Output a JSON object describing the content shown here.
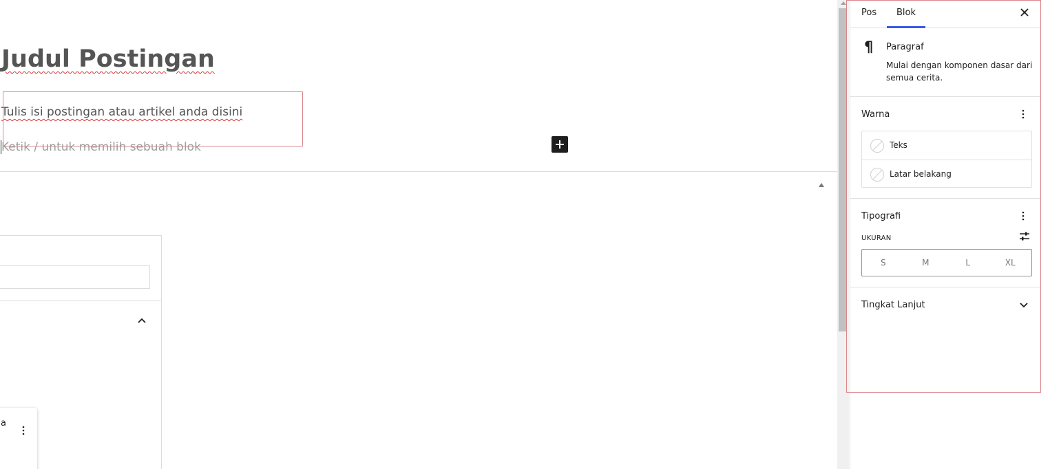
{
  "editor": {
    "post_title": "Judul Postingan",
    "paragraph_text": "Tulis isi postingan atau artikel anda disini",
    "appender_placeholder": "Ketik / untuk memilih sebuah blok",
    "popover_text": "a"
  },
  "sidebar": {
    "tabs": [
      {
        "label": "Pos",
        "active": false
      },
      {
        "label": "Blok",
        "active": true
      }
    ],
    "block_card": {
      "icon": "paragraph-icon",
      "title": "Paragraf",
      "description": "Mulai dengan komponen dasar dari semua cerita."
    },
    "color_panel": {
      "title": "Warna",
      "items": [
        {
          "label": "Teks"
        },
        {
          "label": "Latar belakang"
        }
      ]
    },
    "typography_panel": {
      "title": "Tipografi",
      "size_label": "UKURAN",
      "sizes": [
        "S",
        "M",
        "L",
        "XL"
      ]
    },
    "advanced_panel": {
      "title": "Tingkat Lanjut"
    }
  },
  "colors": {
    "accent": "#3858e9",
    "highlight_frame": "#d9878d",
    "spellcheck": "#d63638"
  }
}
